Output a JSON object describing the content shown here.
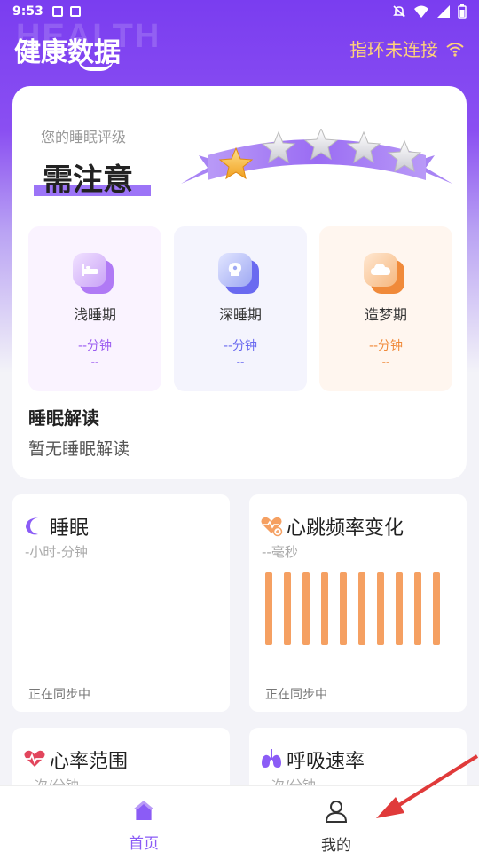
{
  "status_bar": {
    "time": "9:53"
  },
  "header": {
    "watermark": "HEALTH",
    "title": "健康数据",
    "ring_status": "指环未连接"
  },
  "sleep_card": {
    "rating_label": "您的睡眠评级",
    "rating_value": "需注意",
    "stars_filled": 1,
    "stars_total": 5,
    "stages": [
      {
        "name": "浅睡期",
        "duration": "--分钟",
        "percent": "--",
        "color": "#9b5cf0",
        "icon": "bed-icon"
      },
      {
        "name": "深睡期",
        "duration": "--分钟",
        "percent": "--",
        "color": "#6a6af0",
        "icon": "brain-icon"
      },
      {
        "name": "造梦期",
        "duration": "--分钟",
        "percent": "--",
        "color": "#f08a3a",
        "icon": "cloud-icon"
      }
    ],
    "interpretation_title": "睡眠解读",
    "interpretation_text": "暂无睡眠解读"
  },
  "cards": {
    "sleep": {
      "title": "睡眠",
      "subtitle": "-小时-分钟",
      "sync": "正在同步中"
    },
    "hrv": {
      "title": "心跳频率变化",
      "subtitle": "--毫秒",
      "sync": "正在同步中",
      "bar_count": 10
    },
    "heart_rate": {
      "title": "心率范围",
      "subtitle": "--次/分钟"
    },
    "respiration": {
      "title": "呼吸速率",
      "subtitle": "--次/分钟"
    }
  },
  "bottom_nav": {
    "items": [
      {
        "label": "首页",
        "active": true
      },
      {
        "label": "我的",
        "active": false
      }
    ]
  },
  "colors": {
    "accent": "#8b5cf6",
    "ring_status": "#ffd27a",
    "hrv_bar": "#f5a062",
    "annotation_arrow": "#e03a3a"
  }
}
